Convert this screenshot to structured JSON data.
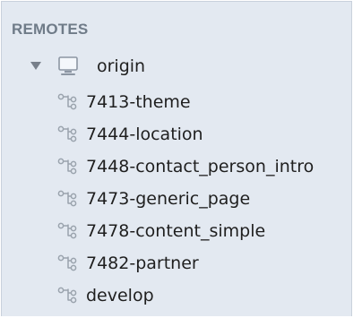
{
  "sidebar": {
    "section_title": "REMOTES",
    "remote": {
      "label": "origin",
      "icon": "computer-icon",
      "expanded": true
    },
    "branches": [
      {
        "label": "7413-theme",
        "icon": "branch-icon"
      },
      {
        "label": "7444-location",
        "icon": "branch-icon"
      },
      {
        "label": "7448-contact_person_intro",
        "icon": "branch-icon"
      },
      {
        "label": "7473-generic_page",
        "icon": "branch-icon"
      },
      {
        "label": "7478-content_simple",
        "icon": "branch-icon"
      },
      {
        "label": "7482-partner",
        "icon": "branch-icon"
      },
      {
        "label": "develop",
        "icon": "branch-icon"
      }
    ]
  }
}
